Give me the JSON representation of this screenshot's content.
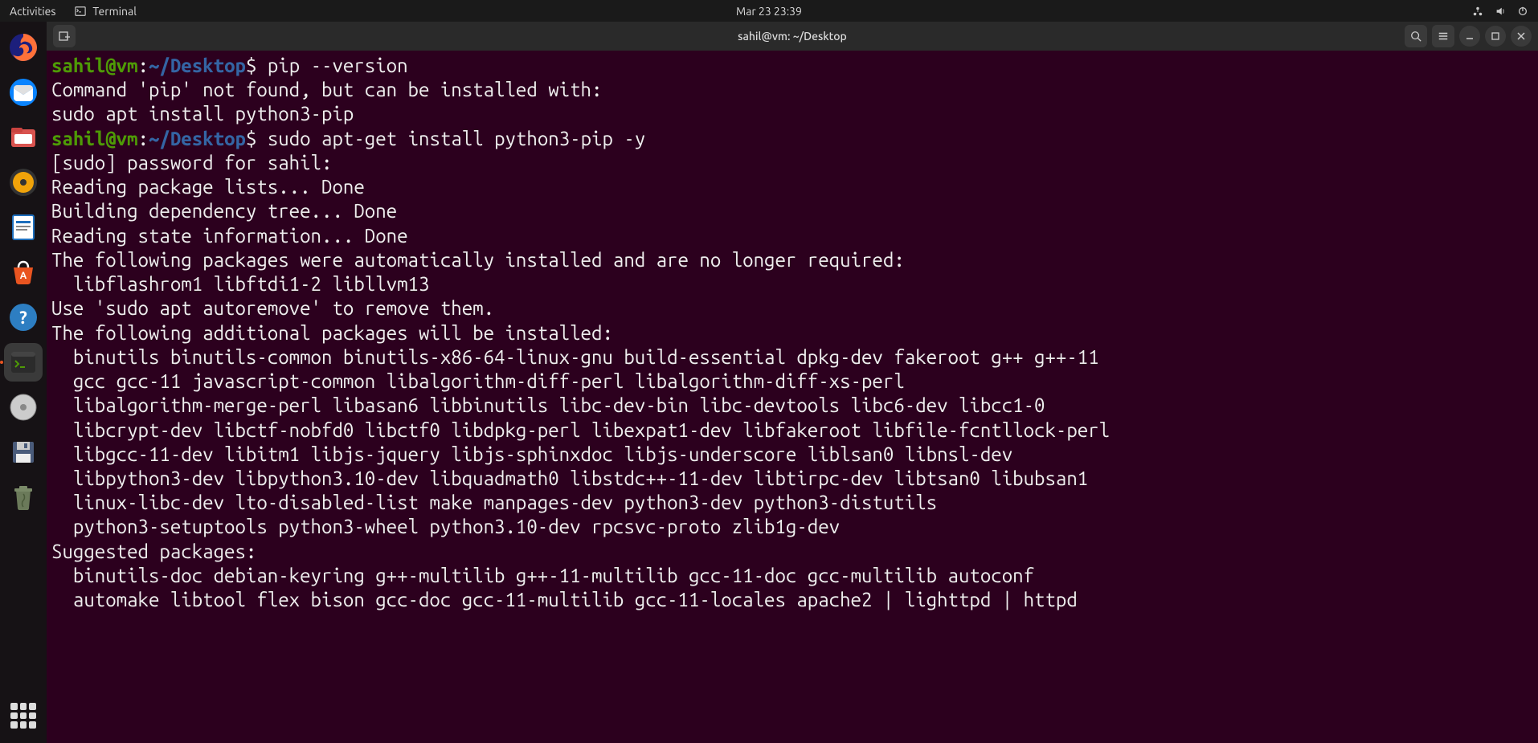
{
  "topbar": {
    "activities": "Activities",
    "app_name": "Terminal",
    "datetime": "Mar 23  23:39"
  },
  "dock": {
    "items": [
      {
        "name": "firefox-icon"
      },
      {
        "name": "thunderbird-icon"
      },
      {
        "name": "files-icon"
      },
      {
        "name": "rhythmbox-icon"
      },
      {
        "name": "libreoffice-writer-icon"
      },
      {
        "name": "software-center-icon"
      },
      {
        "name": "help-icon"
      },
      {
        "name": "terminal-icon",
        "active": true
      },
      {
        "name": "disk-icon"
      },
      {
        "name": "save-icon"
      },
      {
        "name": "trash-icon"
      }
    ]
  },
  "window": {
    "title": "sahil@vm: ~/Desktop"
  },
  "terminal": {
    "prompt_user_host": "sahil@vm",
    "prompt_sep": ":",
    "prompt_path": "~/Desktop",
    "prompt_symbol": "$",
    "cmd1": " pip --version",
    "out1_l1": "Command 'pip' not found, but can be installed with:",
    "out1_l2": "sudo apt install python3-pip",
    "cmd2": " sudo apt-get install python3-pip -y",
    "out2_l1": "[sudo] password for sahil: ",
    "out2_l2": "Reading package lists... Done",
    "out2_l3": "Building dependency tree... Done",
    "out2_l4": "Reading state information... Done",
    "out2_l5": "The following packages were automatically installed and are no longer required:",
    "out2_l6": "  libflashrom1 libftdi1-2 libllvm13",
    "out2_l7": "Use 'sudo apt autoremove' to remove them.",
    "out2_l8": "The following additional packages will be installed:",
    "out2_l9": "  binutils binutils-common binutils-x86-64-linux-gnu build-essential dpkg-dev fakeroot g++ g++-11",
    "out2_l10": "  gcc gcc-11 javascript-common libalgorithm-diff-perl libalgorithm-diff-xs-perl",
    "out2_l11": "  libalgorithm-merge-perl libasan6 libbinutils libc-dev-bin libc-devtools libc6-dev libcc1-0",
    "out2_l12": "  libcrypt-dev libctf-nobfd0 libctf0 libdpkg-perl libexpat1-dev libfakeroot libfile-fcntllock-perl",
    "out2_l13": "  libgcc-11-dev libitm1 libjs-jquery libjs-sphinxdoc libjs-underscore liblsan0 libnsl-dev",
    "out2_l14": "  libpython3-dev libpython3.10-dev libquadmath0 libstdc++-11-dev libtirpc-dev libtsan0 libubsan1",
    "out2_l15": "  linux-libc-dev lto-disabled-list make manpages-dev python3-dev python3-distutils",
    "out2_l16": "  python3-setuptools python3-wheel python3.10-dev rpcsvc-proto zlib1g-dev",
    "out2_l17": "Suggested packages:",
    "out2_l18": "  binutils-doc debian-keyring g++-multilib g++-11-multilib gcc-11-doc gcc-multilib autoconf",
    "out2_l19": "  automake libtool flex bison gcc-doc gcc-11-multilib gcc-11-locales apache2 | lighttpd | httpd"
  }
}
